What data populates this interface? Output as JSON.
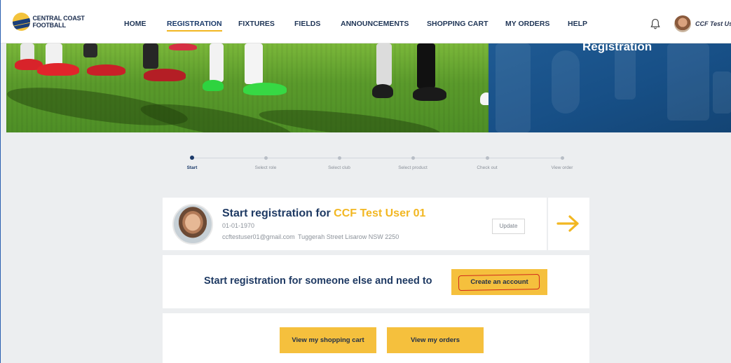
{
  "nav": {
    "logo_text": "CENTRAL COAST FOOTBALL",
    "items": [
      {
        "label": "HOME"
      },
      {
        "label": "REGISTRATION"
      },
      {
        "label": "FIXTURES"
      },
      {
        "label": "FIELDS"
      },
      {
        "label": "ANNOUNCEMENTS"
      },
      {
        "label": "SHOPPING CART"
      },
      {
        "label": "MY ORDERS"
      },
      {
        "label": "HELP"
      }
    ],
    "active": "REGISTRATION",
    "user_name": "CCF Test Us"
  },
  "hero": {
    "title": "Registration"
  },
  "stepper": {
    "steps": [
      {
        "label": "Start"
      },
      {
        "label": "Select role"
      },
      {
        "label": "Select club"
      },
      {
        "label": "Select product"
      },
      {
        "label": "Check out"
      },
      {
        "label": "View order"
      }
    ],
    "active_step": "Start"
  },
  "user_card": {
    "title_prefix": "Start registration for",
    "user_name": "CCF Test User 01",
    "dob": "01-01-1970",
    "email": "ccftestuser01@gmail.com",
    "address": "Tuggerah Street Lisarow NSW 2250",
    "update_label": "Update"
  },
  "someone_card": {
    "text": "Start registration for someone else and need to",
    "create_label": "Create an account"
  },
  "actions": {
    "cart_label": "View my shopping cart",
    "orders_label": "View my orders"
  },
  "colors": {
    "accent": "#f2b722",
    "navy": "#1f3a63",
    "hero_blue": "#174f86"
  }
}
